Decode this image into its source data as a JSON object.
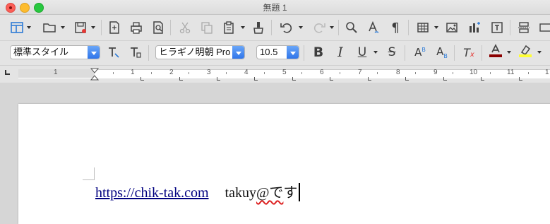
{
  "window": {
    "title": "無題 1"
  },
  "formatting": {
    "paragraph_style": "標準スタイル",
    "font_name": "ヒラギノ明朝 Pro",
    "font_size": "10.5"
  },
  "ruler": {
    "numbers": [
      "1",
      "1",
      "2",
      "3",
      "4",
      "5",
      "6",
      "7",
      "8",
      "9",
      "10",
      "11",
      "1"
    ]
  },
  "document": {
    "link_text": "https://chik-tak.com",
    "text_before_squiggle": "takuy",
    "squiggle_text": "@で",
    "text_after": "す"
  },
  "colors": {
    "font_color": "#8b0000",
    "highlight_color": "#ffff33",
    "link": "#000080"
  }
}
